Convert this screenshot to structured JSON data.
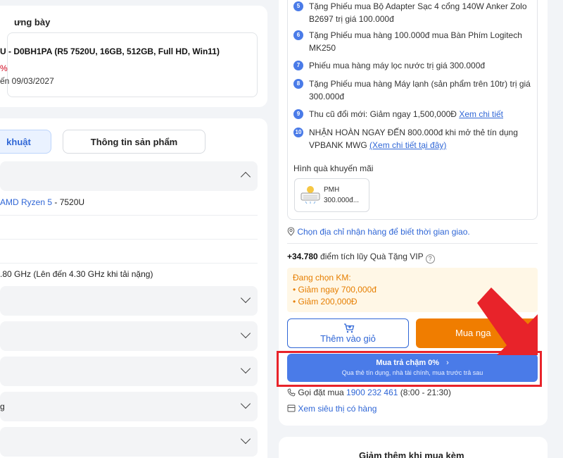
{
  "left_top": {
    "title": "ưng bày",
    "model_name": "U - D0BH1PA (R5 7520U, 16GB, 512GB, Full HD, Win11)",
    "discount": "%",
    "warranty": "ến 09/03/2027"
  },
  "tabs": {
    "active": "khuật",
    "inactive": "Thông tin sản phẩm"
  },
  "specs": {
    "cpu_link": "AMD Ryzen 5",
    "cpu_model": " - 7520U",
    "row2": "",
    "row3": "",
    "speed": ".80 GHz (Lên đến 4.30 GHz khi tải nặng)",
    "accordion_last": "g"
  },
  "promos": [
    {
      "num": "5",
      "text": "Tặng Phiếu mua Bộ Adapter Sạc 4 cổng 140W Anker Zolo B2697 trị giá 100.000đ"
    },
    {
      "num": "6",
      "text": "Tặng Phiếu mua hàng 100.000đ mua Bàn Phím Logitech MK250"
    },
    {
      "num": "7",
      "text": "Phiếu mua hàng máy lọc nước trị giá 300.000đ"
    },
    {
      "num": "8",
      "text": "Tặng Phiếu mua hàng Máy lạnh (sản phẩm trên 10tr) trị giá 300.000đ"
    },
    {
      "num": "9",
      "text": "Thu cũ đổi mới: Giảm ngay 1,500,000Đ ",
      "link": "Xem chi tiết"
    },
    {
      "num": "10",
      "text": "NHẬN HOÀN NGAY ĐẾN 800.000đ khi mở thẻ tín dụng VPBANK MWG ",
      "link": "(Xem chi tiết tại đây)"
    }
  ],
  "gift": {
    "label": "Hình quà khuyến mãi",
    "line1": "PMH",
    "line2": "300.000đ..."
  },
  "address_prompt": "Chọn địa chỉ nhận hàng để biết thời gian giao.",
  "points": {
    "value": "+34.780",
    "text": " điểm tích lũy Quà Tặng VIP"
  },
  "selected_promos": {
    "title": "Đang chọn KM:",
    "items": [
      "•  Giảm ngay 700,000đ",
      "•  Giảm 200,000Đ"
    ]
  },
  "buttons": {
    "add_to_cart": "Thêm vào giỏ",
    "buy_now": "Mua nga",
    "installment_title": "Mua trả chậm 0%",
    "installment_sub": "Qua thẻ tín dụng, nhà tài chính, mua trước trả sau"
  },
  "hotline": {
    "label": "Gọi đặt mua ",
    "number": "1900 232 461",
    "hours": " (8:00 - 21:30)"
  },
  "store_link": "Xem siêu thị có hàng",
  "bottom_section_title": "Giảm thêm khi mua kèm",
  "colors": {
    "accent_blue": "#4a7be8",
    "buy_orange": "#f07d00",
    "highlight_red": "#e8232a"
  }
}
